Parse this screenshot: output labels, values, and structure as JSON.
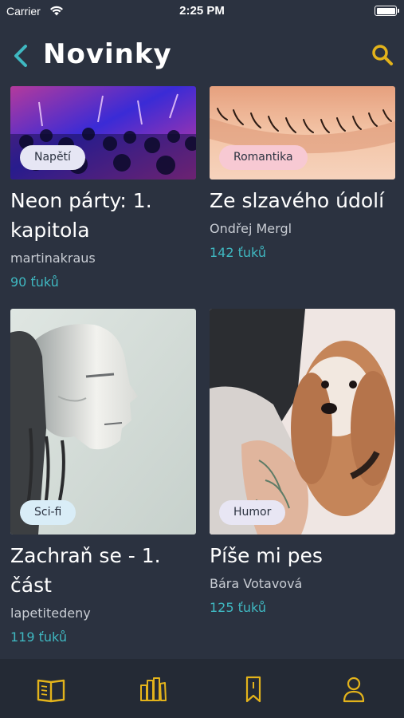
{
  "status_bar": {
    "carrier": "Carrier",
    "time": "2:25 PM"
  },
  "header": {
    "title": "Novinky",
    "back_icon": "chevron-left-icon",
    "search_icon": "search-icon"
  },
  "colors": {
    "background": "#2b3240",
    "accent": "#3fb8c1",
    "tab_icon": "#e3b31b",
    "tab_bar": "#242a35"
  },
  "cards": [
    {
      "tag": "Napětí",
      "title_line1": "Neon párty: 1.",
      "title_line2": "kapitola",
      "author": "martinakraus",
      "likes": "90 ťuků",
      "tag_color": "#e6e6f4",
      "image": "concert-crowd"
    },
    {
      "tag": "Romantika",
      "title_line1": "Ze slzavého údolí",
      "title_line2": "",
      "author": "Ondřej Mergl",
      "likes": "142 ťuků",
      "tag_color": "#f7c9d3",
      "image": "eyelash-closeup"
    },
    {
      "tag": "Sci-fi",
      "title_line1": "Zachraň se - 1.",
      "title_line2": "část",
      "author": "lapetitedeny",
      "likes": "119 ťuků",
      "tag_color": "#d9edf7",
      "image": "robot-head"
    },
    {
      "tag": "Humor",
      "title_line1": "Píše mi pes",
      "title_line2": "",
      "author": "Bára Votavová",
      "likes": "125 ťuků",
      "tag_color": "#e8e6f4",
      "image": "dog-portrait"
    }
  ],
  "tabbar": {
    "items": [
      {
        "icon": "open-book-icon",
        "active": true
      },
      {
        "icon": "library-books-icon",
        "active": false
      },
      {
        "icon": "bookmark-icon",
        "active": false
      },
      {
        "icon": "profile-icon",
        "active": false
      }
    ]
  }
}
